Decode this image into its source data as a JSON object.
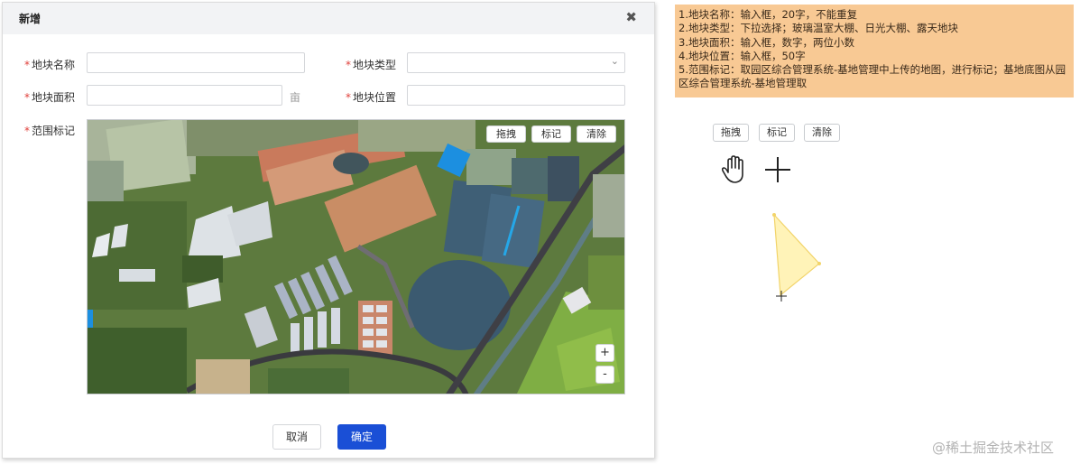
{
  "dialog": {
    "title": "新增",
    "close_glyph": "✖",
    "required_mark": "*",
    "fields": {
      "name_label": "地块名称",
      "type_label": "地块类型",
      "area_label": "地块面积",
      "area_unit": "亩",
      "location_label": "地块位置",
      "range_label": "范围标记"
    },
    "select_chevron": "⌄",
    "map": {
      "drag_label": "拖拽",
      "mark_label": "标记",
      "clear_label": "清除",
      "zoom_in": "+",
      "zoom_out": "-"
    },
    "cancel_label": "取消",
    "confirm_label": "确定"
  },
  "notes": [
    "1.地块名称：输入框，20字，不能重复",
    "2.地块类型：下拉选择；玻璃温室大棚、日光大棚、露天地块",
    "3.地块面积：输入框，数字，两位小数",
    "4.地块位置：输入框，50字",
    "5.范围标记：取园区综合管理系统-基地管理中上传的地图，进行标记；基地底图从园区综合管理系统-基地管理取"
  ],
  "demo": {
    "drag_label": "拖拽",
    "mark_label": "标记",
    "clear_label": "清除",
    "hand_icon": "hand-icon",
    "crosshair_icon": "crosshair-icon"
  },
  "watermark": "@稀土掘金技术社区",
  "colors": {
    "notes_bg": "#f8c994",
    "primary": "#1a4fd6",
    "required": "#e0413b",
    "polygon_fill": "#fff3b8",
    "polygon_stroke": "#f2d46a"
  }
}
